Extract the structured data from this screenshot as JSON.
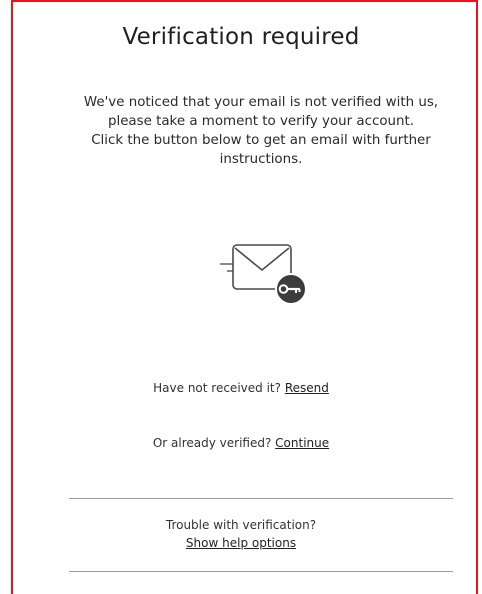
{
  "dialog": {
    "title": "Verification required",
    "intro_lines": [
      "We've noticed that your email is not verified with us,",
      "please take a moment to verify your account.",
      "Click the button below to get an email with further",
      "instructions."
    ],
    "illustration_icon": "envelope-with-key-icon",
    "resend_prompt": "Have not received it?",
    "resend_link": "Resend",
    "continue_prompt": "Or already verified?",
    "continue_link": "Continue",
    "help_prompt": "Trouble with verification?",
    "help_link": "Show help options"
  },
  "colors": {
    "frame_border": "#e8141c",
    "text": "#222222",
    "divider": "#9a9a9a",
    "icon_stroke": "#4a4a4a",
    "badge_fill": "#3c3c3c"
  }
}
